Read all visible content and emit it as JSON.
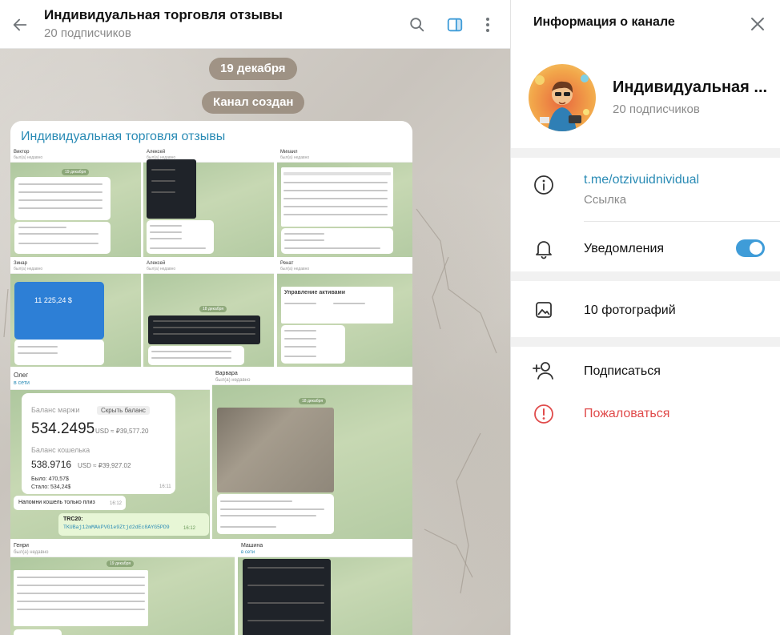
{
  "chat": {
    "title": "Индивидуальная торговля отзывы",
    "subscribers": "20 подписчиков",
    "date_pill": "19 декабря",
    "service_pill": "Канал создан",
    "post_title": "Индивидуальная торговля отзывы"
  },
  "thumbs": {
    "t1": {
      "name": "Виктор",
      "sub": "был(а) недавно"
    },
    "t2": {
      "name": "Алексей",
      "sub": "был(а) недавно"
    },
    "t3": {
      "name": "Михаил",
      "sub": "был(а) недавно"
    },
    "t4": {
      "name": "Зинар",
      "sub": "был(а) недавно",
      "amount": "11 225,24 $"
    },
    "t5": {
      "name": "Алексей",
      "sub": "был(а) недавно"
    },
    "t6": {
      "name": "Ренат",
      "sub": "был(а) недавно",
      "heading": "Управление активами"
    },
    "t7": {
      "name": "Олег",
      "sub": "в сети",
      "margin_label": "Баланс маржи",
      "hide_label": "Скрыть баланс",
      "margin_value": "534.2495",
      "margin_unit": "USD ≈ ₽39,577.20",
      "wallet_label": "Баланс кошелька",
      "wallet_value": "538.9716",
      "wallet_unit": "USD ≈ ₽39,927.02",
      "was": "Было: 470,57$",
      "became": "Стало: 534,24$",
      "time1": "16:11",
      "msg2": "Напомни кошель только плиз",
      "time2": "16:12",
      "trc_label": "TRC20:",
      "trc_addr": "TKUBaj12mMAkPVG1e9Ztjd2dEc8AYG5PD9",
      "time3": "16:12"
    },
    "t8": {
      "name": "Варвара",
      "sub": "был(а) недавно"
    },
    "t9": {
      "name": "Генри",
      "sub": "был(а) недавно"
    },
    "t10": {
      "name": "Машина",
      "sub": "в сети"
    }
  },
  "panel": {
    "title": "Информация о канале",
    "channel_name": "Индивидуальная ...",
    "subscribers": "20 подписчиков",
    "link": "t.me/otzivuidnividual",
    "link_caption": "Ссылка",
    "notifications": "Уведомления",
    "notifications_on": true,
    "photos": "10 фотографий",
    "subscribe": "Подписаться",
    "report": "Пожаловаться"
  },
  "colors": {
    "accent": "#3f9cd8",
    "link": "#2a8bb5",
    "danger": "#e04b4b"
  }
}
